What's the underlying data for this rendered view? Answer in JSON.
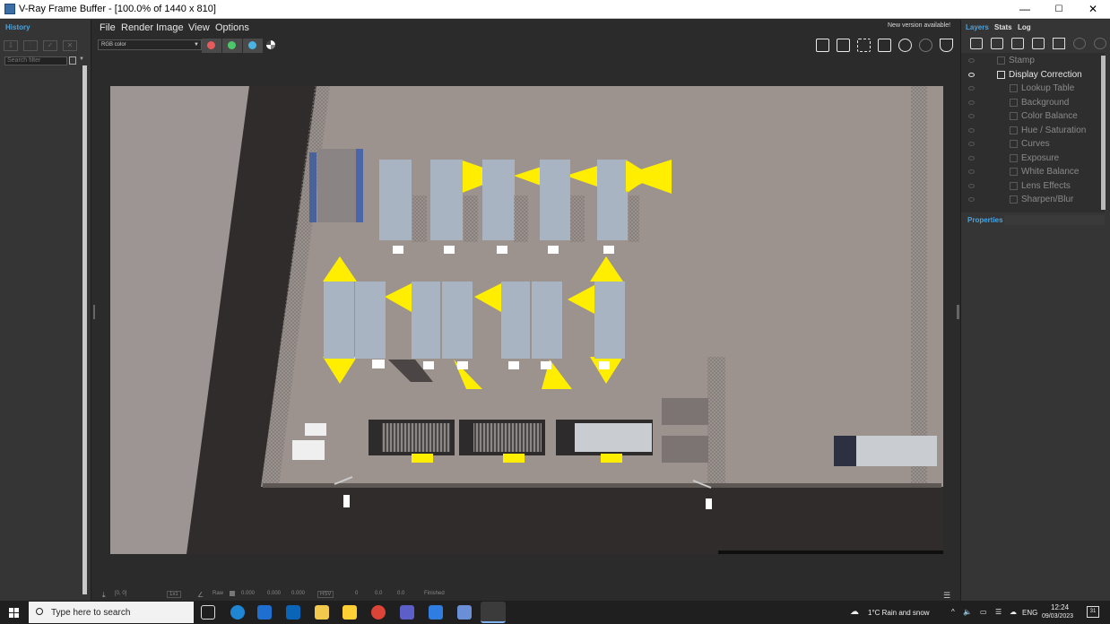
{
  "window": {
    "title": "V-Ray Frame Buffer - [100.0% of 1440 x 810]",
    "minimize": "—",
    "maximize": "☐",
    "close": "✕"
  },
  "history_panel": {
    "tab": "History",
    "search_placeholder": "Search filter"
  },
  "menu": {
    "file": "File",
    "render": "Render",
    "image": "Image",
    "view": "View",
    "options": "Options"
  },
  "notice": "New version available!",
  "toolbar": {
    "channel": "RGB color",
    "colors": {
      "red": "#e55b5b",
      "green": "#4cc86a",
      "blue": "#4ab3e6"
    }
  },
  "statusbar": {
    "coords": "[0, 0]",
    "zoom": "1x1",
    "raw_label": "Raw",
    "r": "0.000",
    "g": "0.000",
    "b": "0.000",
    "mode": "HSV",
    "h": "0",
    "s": "0.0",
    "v": "0.0",
    "state": "Finished"
  },
  "right_panel": {
    "tabs": {
      "layers": "Layers",
      "stats": "Stats",
      "log": "Log"
    },
    "layers": [
      {
        "label": "Stamp",
        "active": false
      },
      {
        "label": "Display Correction",
        "active": true
      },
      {
        "label": "Lookup Table",
        "active": false
      },
      {
        "label": "Background",
        "active": false
      },
      {
        "label": "Color Balance",
        "active": false
      },
      {
        "label": "Hue / Saturation",
        "active": false
      },
      {
        "label": "Curves",
        "active": false
      },
      {
        "label": "Exposure",
        "active": false
      },
      {
        "label": "White Balance",
        "active": false
      },
      {
        "label": "Lens Effects",
        "active": false
      },
      {
        "label": "Sharpen/Blur",
        "active": false
      }
    ],
    "properties": "Properties"
  },
  "taskbar": {
    "search_placeholder": "Type here to search",
    "weather": "1°C  Rain and snow",
    "lang": "ENG",
    "time": "12:24",
    "date": "09/03/2023",
    "notif_count": "31",
    "accent": "#ffe000"
  }
}
